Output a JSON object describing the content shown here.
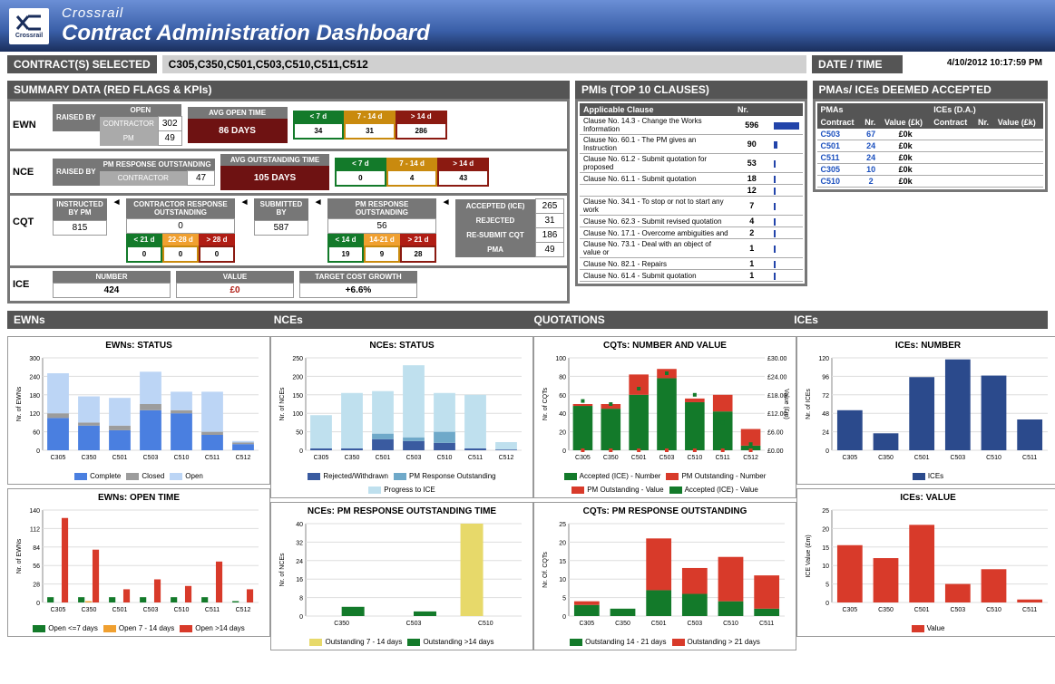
{
  "header": {
    "brand": "Crossrail",
    "title": "Contract Administration Dashboard",
    "logo_text": "Crossrail"
  },
  "contract_selected_label": "CONTRACT(S) SELECTED",
  "contracts_selected": "C305,C350,C501,C503,C510,C511,C512",
  "datetime_label": "DATE / TIME",
  "datetime_value": "4/10/2012 10:17:59 PM",
  "summary_label": "SUMMARY DATA (RED FLAGS & KPIs)",
  "pmi_label": "PMIs (TOP 10 CLAUSES)",
  "pma_label": "PMAs/ ICEs DEEMED ACCEPTED",
  "ewn": {
    "name": "EWN",
    "raised_by": "RAISED BY",
    "open": "OPEN",
    "contractor": "CONTRACTOR",
    "pm": "PM",
    "contractor_n": 302,
    "pm_n": 49,
    "avg_open_label": "AVG OPEN TIME",
    "avg_open_value": "86 DAYS",
    "bands": {
      "lt7": "< 7 d",
      "b714": "7 - 14 d",
      "gt14": "> 14 d"
    },
    "band_vals": {
      "lt7": 34,
      "b714": 31,
      "gt14": 286
    }
  },
  "nce": {
    "name": "NCE",
    "raised_by": "RAISED BY",
    "pm_resp_label": "PM RESPONSE OUTSTANDING",
    "contractor": "CONTRACTOR",
    "pm_resp_n": 47,
    "avg_out_label": "AVG OUTSTANDING TIME",
    "avg_out_value": "105 DAYS",
    "bands": {
      "lt7": "< 7 d",
      "b714": "7 - 14 d",
      "gt14": "> 14 d"
    },
    "band_vals": {
      "lt7": 0,
      "b714": 4,
      "gt14": 43
    }
  },
  "cqt": {
    "name": "CQT",
    "instructed_label": "INSTRUCTED BY PM",
    "instructed_n": 815,
    "cro_label": "CONTRACTOR RESPONSE OUTSTANDING",
    "cro_total": 0,
    "cro_bands": {
      "lt21": "< 21 d",
      "b2228": "22-28 d",
      "gt28": "> 28 d"
    },
    "cro_vals": {
      "lt21": 0,
      "b2228": 0,
      "gt28": 0
    },
    "submitted_label": "SUBMITTED BY",
    "submitted_n": 587,
    "pm_resp_label": "PM RESPONSE OUTSTANDING",
    "pm_resp_total": 56,
    "pm_bands": {
      "lt14": "< 14 d",
      "b1421": "14-21 d",
      "gt21": "> 21 d"
    },
    "pm_vals": {
      "lt14": 19,
      "b1421": 9,
      "gt21": 28
    },
    "outcome": {
      "accepted_label": "ACCEPTED (ICE)",
      "accepted": 265,
      "rejected_label": "REJECTED",
      "rejected": 31,
      "resubmit_label": "RE-SUBMIT CQT",
      "resubmit": 186,
      "pma_label": "PMA",
      "pma": 49
    }
  },
  "ice": {
    "name": "ICE",
    "number_label": "NUMBER",
    "number": 424,
    "value_label": "VALUE",
    "value": "£0",
    "tcg_label": "TARGET COST GROWTH",
    "tcg": "+6.6%"
  },
  "pmi": {
    "col_clause": "Applicable Clause",
    "col_nr": "Nr.",
    "rows": [
      {
        "clause": "Clause No. 14.3 - Change the Works Information",
        "nr": 596
      },
      {
        "clause": "Clause No. 60.1 - The PM gives an Instruction",
        "nr": 90
      },
      {
        "clause": "Clause No. 61.2 - Submit quotation for proposed",
        "nr": 53
      },
      {
        "clause": "Clause No. 61.1 - Submit quotation",
        "nr": 18
      },
      {
        "clause": "",
        "nr": 12
      },
      {
        "clause": "Clause No. 34.1 - To stop or not to start any work",
        "nr": 7
      },
      {
        "clause": "Clause No. 62.3 - Submit revised quotation",
        "nr": 4
      },
      {
        "clause": "Clause No. 17.1 - Overcome ambiguities and",
        "nr": 2
      },
      {
        "clause": "Clause No. 73.1 - Deal with an object of value or",
        "nr": 1
      },
      {
        "clause": "Clause No. 82.1 - Repairs",
        "nr": 1
      },
      {
        "clause": "Clause No. 61.4 - Submit quotation",
        "nr": 1
      }
    ]
  },
  "pma": {
    "pmas_label": "PMAs",
    "ices_label": "ICEs (D.A.)",
    "cols": {
      "contract": "Contract",
      "nr": "Nr.",
      "value": "Value (£k)"
    },
    "rows": [
      {
        "c": "C503",
        "nr": 67,
        "val": "£0k"
      },
      {
        "c": "C501",
        "nr": 24,
        "val": "£0k"
      },
      {
        "c": "C511",
        "nr": 24,
        "val": "£0k"
      },
      {
        "c": "C305",
        "nr": 10,
        "val": "£0k"
      },
      {
        "c": "C510",
        "nr": 2,
        "val": "£0k"
      }
    ]
  },
  "panels": {
    "ewns": "EWNs",
    "nces": "NCEs",
    "quotations": "QUOTATIONS",
    "ices": "ICEs"
  },
  "chart_data": [
    {
      "id": "ewn_status",
      "type": "stacked-bar",
      "title": "EWNs: STATUS",
      "xlabel": "",
      "ylabel": "Nr. of EWNs",
      "ylim": [
        0,
        300
      ],
      "categories": [
        "C305",
        "C350",
        "C501",
        "C503",
        "C510",
        "C511",
        "C512"
      ],
      "series": [
        {
          "name": "Complete",
          "color": "#4a7fe0",
          "values": [
            105,
            80,
            65,
            130,
            120,
            50,
            20
          ]
        },
        {
          "name": "Closed",
          "color": "#9c9c9c",
          "values": [
            15,
            10,
            15,
            20,
            10,
            10,
            5
          ]
        },
        {
          "name": "Open",
          "color": "#bcd5f5",
          "values": [
            130,
            85,
            90,
            105,
            60,
            130,
            5
          ]
        }
      ]
    },
    {
      "id": "ewn_open",
      "type": "grouped-bar",
      "title": "EWNs: OPEN TIME",
      "ylabel": "Nr. of EWNs",
      "ylim": [
        0,
        140
      ],
      "categories": [
        "C305",
        "C350",
        "C501",
        "C503",
        "C510",
        "C511",
        "C512"
      ],
      "series": [
        {
          "name": "Open <=7 days",
          "color": "#137a2a",
          "values": [
            8,
            8,
            8,
            8,
            8,
            8,
            2
          ]
        },
        {
          "name": "Open 7 - 14 days",
          "color": "#f0a030",
          "values": [
            0,
            2,
            0,
            0,
            0,
            0,
            0
          ]
        },
        {
          "name": "Open >14 days",
          "color": "#d83a2a",
          "values": [
            128,
            80,
            20,
            35,
            25,
            62,
            20
          ]
        }
      ]
    },
    {
      "id": "nce_status",
      "type": "stacked-bar",
      "title": "NCEs: STATUS",
      "ylabel": "Nr. of NCEs",
      "ylim": [
        0,
        250
      ],
      "categories": [
        "C305",
        "C350",
        "C501",
        "C503",
        "C510",
        "C511",
        "C512"
      ],
      "series": [
        {
          "name": "Rejected/Withdrawn",
          "color": "#3a5ba0",
          "values": [
            5,
            5,
            30,
            25,
            20,
            5,
            2
          ]
        },
        {
          "name": "PM Response Outstanding",
          "color": "#6fa9c9",
          "values": [
            0,
            0,
            15,
            10,
            30,
            0,
            0
          ]
        },
        {
          "name": "Progress to ICE",
          "color": "#bfe0ee",
          "values": [
            90,
            150,
            115,
            195,
            105,
            145,
            20
          ]
        }
      ]
    },
    {
      "id": "nce_out",
      "type": "grouped-bar",
      "title": "NCEs: PM RESPONSE OUTSTANDING TIME",
      "ylabel": "Nr. of NCEs",
      "ylim": [
        0,
        40
      ],
      "categories": [
        "C350",
        "C503",
        "C510"
      ],
      "series": [
        {
          "name": "Outstanding 7 - 14 days",
          "color": "#e7d96a",
          "values": [
            0,
            0,
            40
          ]
        },
        {
          "name": "Outstanding >14 days",
          "color": "#137a2a",
          "values": [
            4,
            2,
            0
          ]
        }
      ]
    },
    {
      "id": "cqt_nv",
      "type": "stacked-bar",
      "title": "CQTs: NUMBER AND VALUE",
      "ylabel": "Nr. of CQTs",
      "y2label": "Value (£m)",
      "ylim": [
        0,
        100
      ],
      "y2lim": [
        0,
        30
      ],
      "categories": [
        "C305",
        "C350",
        "C501",
        "C503",
        "C510",
        "C511",
        "C512"
      ],
      "series": [
        {
          "name": "Accepted (ICE) - Number",
          "color": "#137a2a",
          "values": [
            48,
            45,
            60,
            78,
            52,
            42,
            5
          ]
        },
        {
          "name": "PM Outstanding - Number",
          "color": "#d83a2a",
          "values": [
            2,
            5,
            22,
            10,
            4,
            18,
            18
          ]
        }
      ],
      "points": [
        {
          "name": "PM Outstanding - Value",
          "color": "#d83a2a",
          "values": [
            0,
            0,
            0,
            0,
            0,
            0,
            0
          ]
        },
        {
          "name": "Accepted (ICE) - Value",
          "color": "#137a2a",
          "values": [
            16,
            15,
            20,
            25,
            18,
            9,
            2
          ]
        }
      ]
    },
    {
      "id": "cqt_out",
      "type": "stacked-bar",
      "title": "CQTs: PM RESPONSE OUTSTANDING",
      "ylabel": "Nr. Of. CQTs",
      "ylim": [
        0,
        25
      ],
      "categories": [
        "C305",
        "C350",
        "C501",
        "C503",
        "C510",
        "C511"
      ],
      "series": [
        {
          "name": "Outstanding 14 - 21 days",
          "color": "#137a2a",
          "values": [
            3,
            2,
            7,
            6,
            4,
            2
          ]
        },
        {
          "name": "Outstanding > 21 days",
          "color": "#d83a2a",
          "values": [
            1,
            0,
            14,
            7,
            12,
            9
          ]
        }
      ]
    },
    {
      "id": "ice_num",
      "type": "bar",
      "title": "ICEs: NUMBER",
      "ylabel": "Nr. of ICEs",
      "ylim": [
        0,
        120
      ],
      "categories": [
        "C305",
        "C350",
        "C501",
        "C503",
        "C510",
        "C511"
      ],
      "series": [
        {
          "name": "ICEs",
          "color": "#2b4a8c",
          "values": [
            52,
            22,
            95,
            118,
            97,
            40
          ]
        }
      ]
    },
    {
      "id": "ice_val",
      "type": "bar",
      "title": "ICEs: VALUE",
      "ylabel": "ICE Value (£m)",
      "ylim": [
        0,
        25
      ],
      "categories": [
        "C305",
        "C350",
        "C501",
        "C503",
        "C510",
        "C511"
      ],
      "series": [
        {
          "name": "Value",
          "color": "#d83a2a",
          "values": [
            15.5,
            12,
            21,
            5,
            9,
            0.8
          ]
        }
      ]
    }
  ]
}
